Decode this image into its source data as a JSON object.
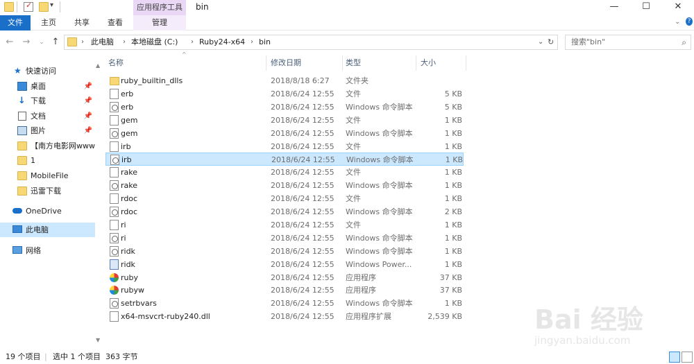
{
  "window": {
    "title": "bin",
    "context_tab": "应用程序工具",
    "controls": [
      "—",
      "☐",
      "✕"
    ]
  },
  "ribbon": {
    "tabs": [
      "文件",
      "主页",
      "共享",
      "查看",
      "管理"
    ]
  },
  "address": {
    "crumbs": [
      "此电脑",
      "本地磁盘 (C:)",
      "Ruby24-x64",
      "bin"
    ],
    "search_placeholder": "搜索\"bin\""
  },
  "sidebar": {
    "items": [
      {
        "label": "快速访问",
        "icon": "star-icon"
      },
      {
        "label": "桌面",
        "icon": "desktop-icon",
        "pinned": true
      },
      {
        "label": "下载",
        "icon": "download-icon",
        "pinned": true
      },
      {
        "label": "文档",
        "icon": "documents-icon",
        "pinned": true
      },
      {
        "label": "图片",
        "icon": "pictures-icon",
        "pinned": true
      },
      {
        "label": "【南方电影网www.",
        "icon": "folder-icon"
      },
      {
        "label": "1",
        "icon": "folder-icon"
      },
      {
        "label": "MobileFile",
        "icon": "folder-icon"
      },
      {
        "label": "迅雷下载",
        "icon": "folder-icon"
      },
      {
        "label": "OneDrive",
        "icon": "cloud-icon"
      },
      {
        "label": "此电脑",
        "icon": "computer-icon",
        "selected": true
      },
      {
        "label": "网络",
        "icon": "network-icon"
      }
    ]
  },
  "columns": {
    "name": "名称",
    "date": "修改日期",
    "type": "类型",
    "size": "大小"
  },
  "files": [
    {
      "name": "ruby_builtin_dlls",
      "date": "2018/8/18 6:27",
      "type": "文件夹",
      "size": "",
      "icon": "folder-icon"
    },
    {
      "name": "erb",
      "date": "2018/6/24 12:55",
      "type": "文件",
      "size": "5 KB",
      "icon": "file-icon"
    },
    {
      "name": "erb",
      "date": "2018/6/24 12:55",
      "type": "Windows 命令脚本",
      "size": "5 KB",
      "icon": "cmd-script-icon"
    },
    {
      "name": "gem",
      "date": "2018/6/24 12:55",
      "type": "文件",
      "size": "1 KB",
      "icon": "file-icon"
    },
    {
      "name": "gem",
      "date": "2018/6/24 12:55",
      "type": "Windows 命令脚本",
      "size": "1 KB",
      "icon": "cmd-script-icon"
    },
    {
      "name": "irb",
      "date": "2018/6/24 12:55",
      "type": "文件",
      "size": "1 KB",
      "icon": "file-icon"
    },
    {
      "name": "irb",
      "date": "2018/6/24 12:55",
      "type": "Windows 命令脚本",
      "size": "1 KB",
      "icon": "cmd-script-icon",
      "selected": true
    },
    {
      "name": "rake",
      "date": "2018/6/24 12:55",
      "type": "文件",
      "size": "1 KB",
      "icon": "file-icon"
    },
    {
      "name": "rake",
      "date": "2018/6/24 12:55",
      "type": "Windows 命令脚本",
      "size": "1 KB",
      "icon": "cmd-script-icon"
    },
    {
      "name": "rdoc",
      "date": "2018/6/24 12:55",
      "type": "文件",
      "size": "1 KB",
      "icon": "file-icon"
    },
    {
      "name": "rdoc",
      "date": "2018/6/24 12:55",
      "type": "Windows 命令脚本",
      "size": "2 KB",
      "icon": "cmd-script-icon"
    },
    {
      "name": "ri",
      "date": "2018/6/24 12:55",
      "type": "文件",
      "size": "1 KB",
      "icon": "file-icon"
    },
    {
      "name": "ri",
      "date": "2018/6/24 12:55",
      "type": "Windows 命令脚本",
      "size": "1 KB",
      "icon": "cmd-script-icon"
    },
    {
      "name": "ridk",
      "date": "2018/6/24 12:55",
      "type": "Windows 命令脚本",
      "size": "1 KB",
      "icon": "cmd-script-icon"
    },
    {
      "name": "ridk",
      "date": "2018/6/24 12:55",
      "type": "Windows Power...",
      "size": "1 KB",
      "icon": "powershell-script-icon"
    },
    {
      "name": "ruby",
      "date": "2018/6/24 12:55",
      "type": "应用程序",
      "size": "37 KB",
      "icon": "ruby-exe-icon"
    },
    {
      "name": "rubyw",
      "date": "2018/6/24 12:55",
      "type": "应用程序",
      "size": "37 KB",
      "icon": "ruby-exe-icon"
    },
    {
      "name": "setrbvars",
      "date": "2018/6/24 12:55",
      "type": "Windows 命令脚本",
      "size": "1 KB",
      "icon": "cmd-script-icon"
    },
    {
      "name": "x64-msvcrt-ruby240.dll",
      "date": "2018/6/24 12:55",
      "type": "应用程序扩展",
      "size": "2,539 KB",
      "icon": "dll-icon"
    }
  ],
  "status": {
    "item_count": "19 个项目",
    "selection": "选中 1 个项目",
    "selection_size": "363 字节"
  },
  "watermark": {
    "text": "Bai 经验",
    "url": "jingyan.baidu.com"
  }
}
